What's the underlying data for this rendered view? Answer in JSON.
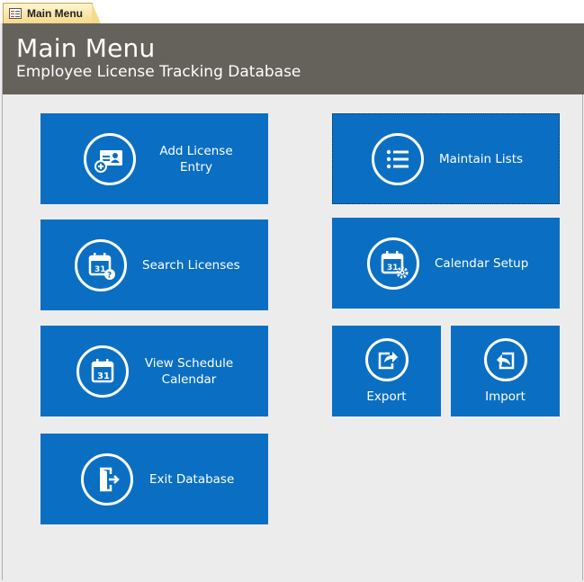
{
  "tab": {
    "label": "Main Menu",
    "icon": "form-icon"
  },
  "header": {
    "title": "Main Menu",
    "subtitle": "Employee License Tracking Database"
  },
  "colors": {
    "tile": "#0a6fc2",
    "header": "#65615b",
    "background": "#ececec"
  },
  "buttons": {
    "add_license": {
      "label": "Add License Entry",
      "icon": "license-card-add-icon"
    },
    "search_licenses": {
      "label": "Search Licenses",
      "icon": "calendar-search-icon"
    },
    "view_schedule": {
      "label": "View Schedule Calendar",
      "icon": "calendar-icon"
    },
    "exit_database": {
      "label": "Exit Database",
      "icon": "exit-door-icon"
    },
    "maintain_lists": {
      "label": "Maintain Lists",
      "icon": "list-icon"
    },
    "calendar_setup": {
      "label": "Calendar Setup",
      "icon": "calendar-gear-icon"
    },
    "export": {
      "label": "Export",
      "icon": "export-icon"
    },
    "import": {
      "label": "Import",
      "icon": "import-icon"
    }
  }
}
